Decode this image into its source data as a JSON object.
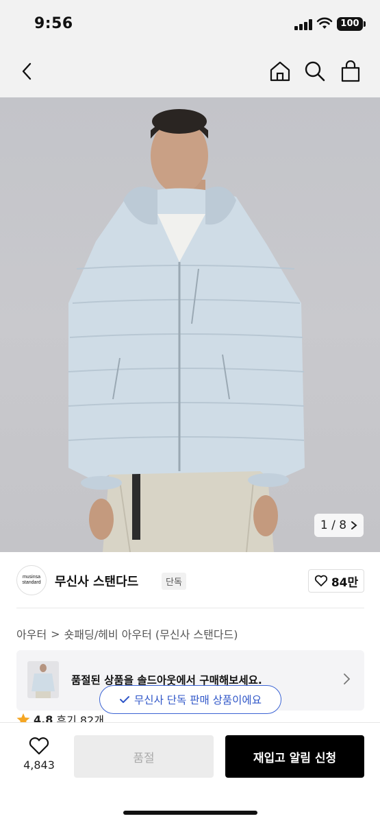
{
  "status_bar": {
    "time": "9:56",
    "battery": "100"
  },
  "nav": {
    "back_icon": "chevron-left-icon",
    "home_icon": "home-icon",
    "search_icon": "search-icon",
    "cart_icon": "shopping-bag-icon"
  },
  "hero": {
    "counter_text": "1 / 8",
    "counter_icon": "chevron-right-icon",
    "current": 1,
    "total": 8
  },
  "brand": {
    "logo_line1": "musinsa",
    "logo_line2": "standard",
    "name": "무신사 스탠다드",
    "tag": "단독",
    "like_count": "84만"
  },
  "breadcrumb": {
    "level1": "아우터",
    "separator": ">",
    "level2": "숏패딩/헤비 아우터 (무신사 스탠다드)"
  },
  "notice": {
    "text": "품절된 상품을 솔드아웃에서 구매해보세요."
  },
  "exclusive_pill": {
    "text": "무신사 단독 판매 상품이에요"
  },
  "rating": {
    "score": "4.8",
    "reviews": "후기 82개"
  },
  "bottom_bar": {
    "wish_count": "4,843",
    "soldout_label": "품절",
    "restock_label": "재입고 알림 신청"
  },
  "colors": {
    "accent_blue": "#2f56c8",
    "primary_black": "#000000",
    "star": "#f5a623",
    "jacket": "#cfdce6"
  }
}
